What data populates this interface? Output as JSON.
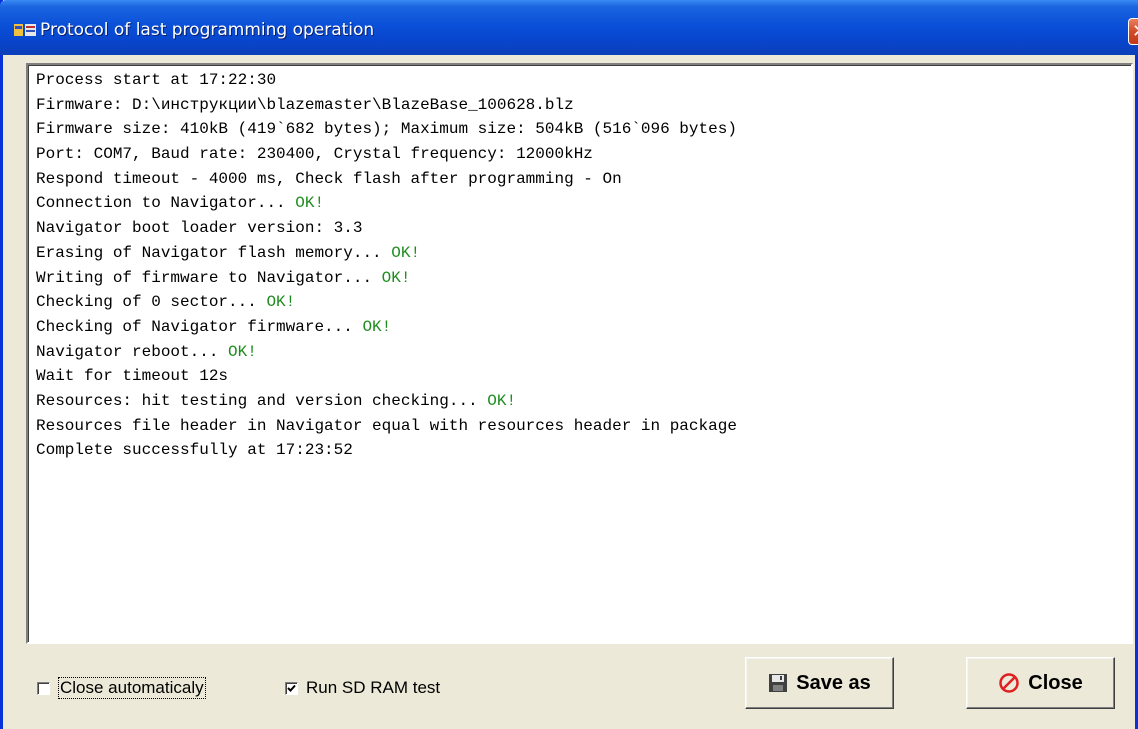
{
  "window": {
    "title": "Protocol of last programming operation",
    "close_glyph": "✕"
  },
  "log": {
    "lines": [
      {
        "text": "Process start at 17:22:30",
        "status": ""
      },
      {
        "text": "Firmware: D:\\инструкции\\blazemaster\\BlazeBase_100628.blz",
        "status": ""
      },
      {
        "text": "Firmware size: 410kB (419`682 bytes); Maximum size: 504kB (516`096 bytes)",
        "status": ""
      },
      {
        "text": "Port: COM7, Baud rate: 230400, Crystal frequency: 12000kHz",
        "status": ""
      },
      {
        "text": "Respond timeout - 4000 ms, Check flash after programming - On",
        "status": ""
      },
      {
        "text": "Connection to Navigator... ",
        "status": "OK!"
      },
      {
        "text": "Navigator boot loader version: 3.3",
        "status": ""
      },
      {
        "text": "Erasing of Navigator flash memory... ",
        "status": "OK!"
      },
      {
        "text": "Writing of firmware to Navigator... ",
        "status": "OK!"
      },
      {
        "text": "Checking of 0 sector... ",
        "status": "OK!"
      },
      {
        "text": "Checking of Navigator firmware... ",
        "status": "OK!"
      },
      {
        "text": "Navigator reboot... ",
        "status": "OK!"
      },
      {
        "text": "Wait for timeout 12s",
        "status": ""
      },
      {
        "text": "Resources: hit testing and version checking... ",
        "status": "OK!"
      },
      {
        "text": "Resources file header in Navigator equal with resources header in package",
        "status": ""
      },
      {
        "text": "Complete successfully at 17:23:52",
        "status": ""
      }
    ],
    "ok_color": "#1e8c1e"
  },
  "options": {
    "close_automatically": {
      "label": "Close automaticaly",
      "checked": false
    },
    "run_sd_ram_test": {
      "label": "Run SD RAM test",
      "checked": true
    }
  },
  "buttons": {
    "save_as": {
      "label": "Save as",
      "icon": "floppy-disk-icon"
    },
    "close": {
      "label": "Close",
      "icon": "no-entry-icon",
      "icon_color": "#e02020"
    }
  },
  "colors": {
    "titlebar": "#0a50d8",
    "window_bg": "#ece9d8",
    "log_bg": "#ffffff"
  }
}
